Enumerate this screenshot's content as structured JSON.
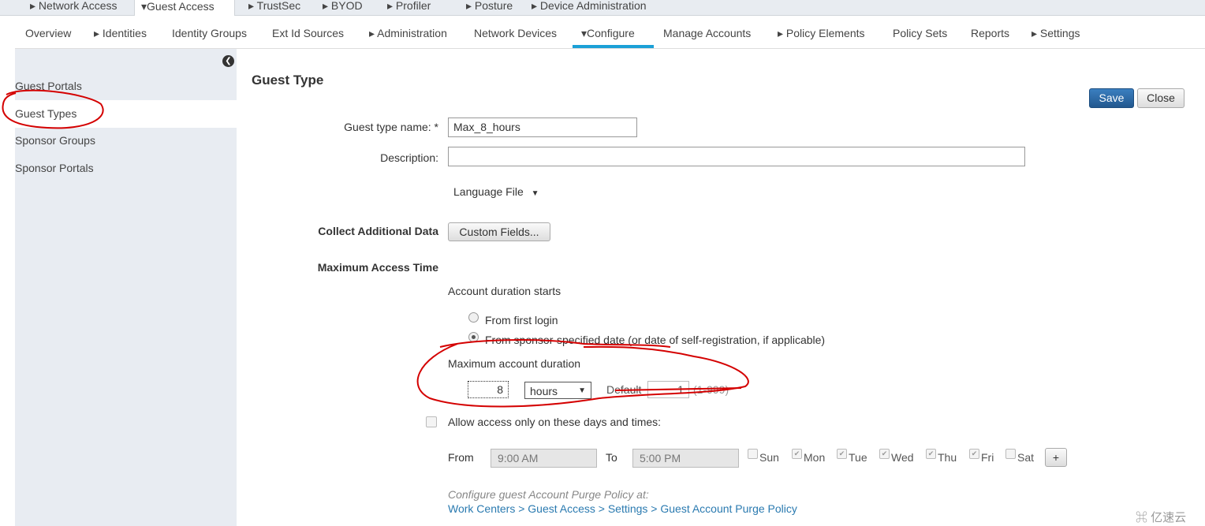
{
  "top_tabs": [
    {
      "label": "Network Access",
      "arrow": "▸"
    },
    {
      "label": "Guest Access",
      "arrow": "▾",
      "active": true
    },
    {
      "label": "TrustSec",
      "arrow": "▸"
    },
    {
      "label": "BYOD",
      "arrow": "▸"
    },
    {
      "label": "Profiler",
      "arrow": "▸"
    },
    {
      "label": "Posture",
      "arrow": "▸"
    },
    {
      "label": "Device Administration",
      "arrow": "▸"
    }
  ],
  "sub_tabs": [
    {
      "label": "Overview",
      "arrow": ""
    },
    {
      "label": "Identities",
      "arrow": "▸"
    },
    {
      "label": "Identity Groups",
      "arrow": ""
    },
    {
      "label": "Ext Id Sources",
      "arrow": ""
    },
    {
      "label": "Administration",
      "arrow": "▸"
    },
    {
      "label": "Network Devices",
      "arrow": ""
    },
    {
      "label": "Configure",
      "arrow": "▾",
      "active": true
    },
    {
      "label": "Manage Accounts",
      "arrow": ""
    },
    {
      "label": "Policy Elements",
      "arrow": "▸"
    },
    {
      "label": "Policy Sets",
      "arrow": ""
    },
    {
      "label": "Reports",
      "arrow": ""
    },
    {
      "label": "Settings",
      "arrow": "▸"
    }
  ],
  "sidebar": {
    "items": [
      {
        "label": "Guest Portals"
      },
      {
        "label": "Guest Types",
        "selected": true
      },
      {
        "label": "Sponsor Groups"
      },
      {
        "label": "Sponsor Portals"
      }
    ],
    "collapse_icon": "chevron-left-icon"
  },
  "page": {
    "title": "Guest Type",
    "save_label": "Save",
    "close_label": "Close"
  },
  "form": {
    "name_label": "Guest type name: *",
    "name_value": "Max_8_hours",
    "description_label": "Description:",
    "description_value": "",
    "language_file": "Language File",
    "collect_label": "Collect Additional Data",
    "custom_fields_label": "Custom Fields...",
    "max_access_label": "Maximum Access Time",
    "duration_starts_label": "Account duration starts",
    "radio_first_login": "From first login",
    "radio_sponsor": "From sponsor-specified date (or date of self-registration, if applicable)",
    "max_duration_label": "Maximum account duration",
    "duration_value": "8",
    "duration_unit": "hours",
    "default_label": "Default",
    "default_value": "1",
    "range_hint": "(1-999)",
    "allow_label": "Allow access only on these days and times:",
    "from_label": "From",
    "from_value": "9:00 AM",
    "to_label": "To",
    "to_value": "5:00 PM",
    "days": [
      {
        "label": "Sun",
        "checked": false
      },
      {
        "label": "Mon",
        "checked": true
      },
      {
        "label": "Tue",
        "checked": true
      },
      {
        "label": "Wed",
        "checked": true
      },
      {
        "label": "Thu",
        "checked": true
      },
      {
        "label": "Fri",
        "checked": true
      },
      {
        "label": "Sat",
        "checked": false
      }
    ],
    "add_label": "+",
    "purge_note": "Configure guest Account Purge Policy at:",
    "purge_link": "Work Centers > Guest Access > Settings > Guest Account Purge Policy"
  },
  "watermark": "亿速云",
  "colors": {
    "accent": "#1ba0d7",
    "save": "#2d6aa5",
    "annotation": "#d40000"
  }
}
